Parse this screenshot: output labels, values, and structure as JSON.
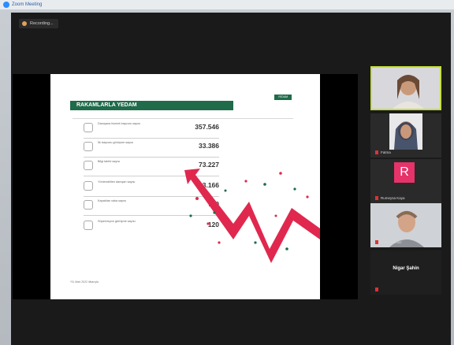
{
  "window": {
    "title": "Zoom Meeting"
  },
  "recording": {
    "label": "Recording..."
  },
  "slide": {
    "title": "RAKAMLARLA YEDAM",
    "logo_text": "YEDAM",
    "rows": [
      {
        "label": "Danışana hizmet başvuru sayısı",
        "value": "357.546"
      },
      {
        "label": "İlk başvuru görüşme sayısı",
        "value": "33.386"
      },
      {
        "label": "Bilgi talebi sayısı",
        "value": "73.227"
      },
      {
        "label": "Yönlendirilen danışan sayısı",
        "value": "13.166"
      },
      {
        "label": "Kapatılan vaka sayısı",
        "value": "790"
      },
      {
        "label": "Süpervizyon görüşme sayısı",
        "value": "120"
      }
    ],
    "footnote": "*31 Mart 2022 itibarıyla"
  },
  "participants": [
    {
      "name": "",
      "initial": ""
    },
    {
      "name": "Fatma",
      "initial": ""
    },
    {
      "name": "Rumeysa Kaya",
      "initial": "R"
    },
    {
      "name": "Şükrü Yılmaz",
      "initial": ""
    },
    {
      "name": "Nigar Şahin",
      "initial": ""
    }
  ],
  "colors": {
    "accent_green": "#1f6b4a",
    "arrow_red": "#e0284f",
    "active_speaker": "#c4df3a",
    "avatar_pink": "#e6336a"
  }
}
